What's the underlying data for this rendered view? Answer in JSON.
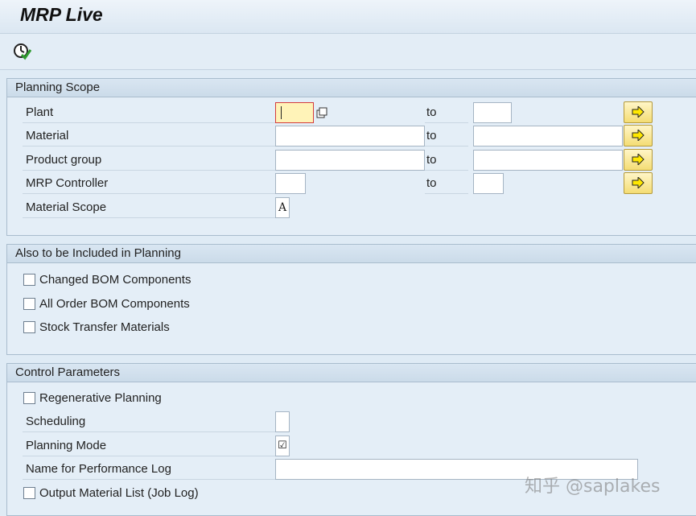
{
  "window": {
    "title": "MRP Live"
  },
  "toolbar": {
    "execute_icon": "execute-clock-check-icon"
  },
  "planning_scope": {
    "header": "Planning Scope",
    "to_label": "to",
    "rows": [
      {
        "label": "Plant",
        "from": "",
        "to": ""
      },
      {
        "label": "Material",
        "from": "",
        "to": ""
      },
      {
        "label": "Product group",
        "from": "",
        "to": ""
      },
      {
        "label": "MRP Controller",
        "from": "",
        "to": ""
      }
    ],
    "material_scope": {
      "label": "Material Scope",
      "value": "A"
    }
  },
  "also_included": {
    "header": "Also to be Included in Planning",
    "items": [
      {
        "label": "Changed BOM Components",
        "checked": false
      },
      {
        "label": "All Order BOM Components",
        "checked": false
      },
      {
        "label": "Stock Transfer Materials",
        "checked": false
      }
    ]
  },
  "control_parameters": {
    "header": "Control Parameters",
    "regenerative_planning": {
      "label": "Regenerative Planning",
      "checked": false
    },
    "scheduling": {
      "label": "Scheduling",
      "value": ""
    },
    "planning_mode": {
      "label": "Planning Mode",
      "value": "☑"
    },
    "performance_log": {
      "label": "Name for Performance Log",
      "value": ""
    },
    "output_material_list": {
      "label": "Output Material List (Job Log)",
      "checked": false
    }
  },
  "watermark": "知乎 @saplakes",
  "colors": {
    "field_active": "#fff3b8",
    "button_yellow": "#f4dd74",
    "background": "#dfebf5"
  }
}
